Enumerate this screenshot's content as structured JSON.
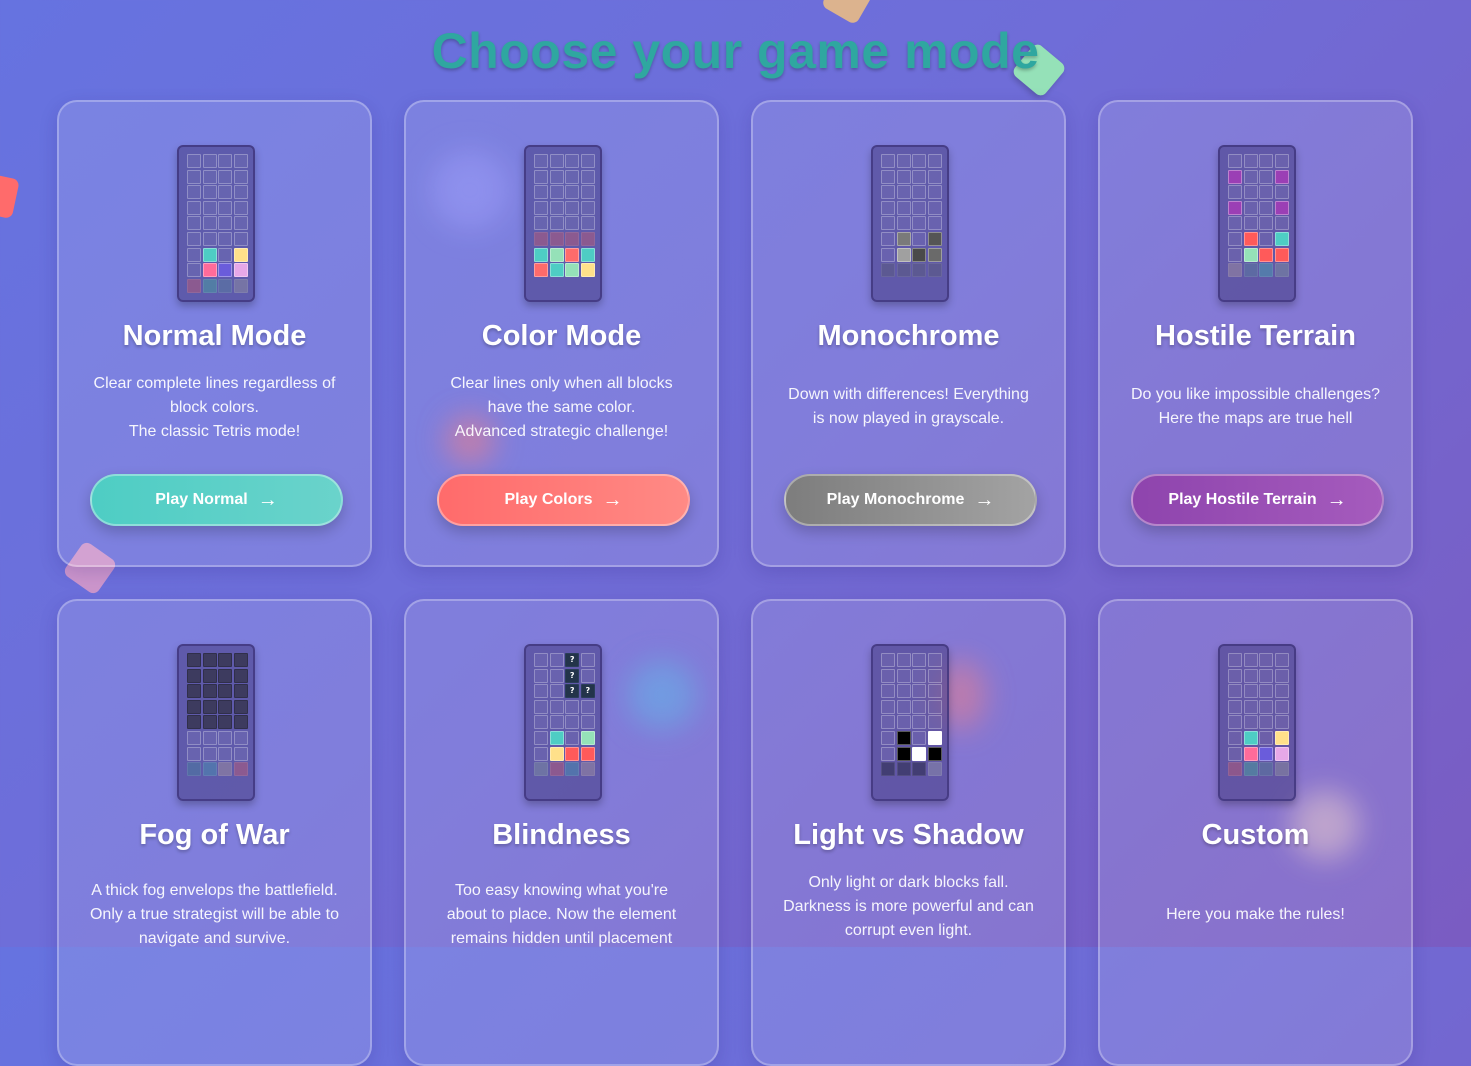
{
  "page": {
    "title": "Choose your game mode"
  },
  "cards": [
    {
      "title": "Normal Mode",
      "description": [
        "Clear complete lines regardless of",
        "block colors.",
        "The classic Tetris mode!"
      ],
      "button": "Play Normal",
      "button_colors": [
        "#4ecdc4",
        "#6ad3cb"
      ],
      "board": [
        "",
        "",
        "",
        "",
        "",
        "",
        "",
        "",
        "",
        "",
        "",
        "",
        "",
        "",
        "",
        "",
        "",
        "",
        "",
        "",
        "",
        "",
        "",
        "",
        "",
        "#4ecdc4",
        "",
        "#ffe08a",
        "",
        "#ff6b9a",
        "#6a5cdb",
        "#e6a8e8",
        "dim:#b05a7a",
        "dim:#4a9aa0",
        "dim:#5a7aa0",
        "dim:#8a8aa0"
      ]
    },
    {
      "title": "Color Mode",
      "description": [
        "Clear lines only when all blocks",
        "have the same color.",
        "Advanced strategic challenge!"
      ],
      "button": "Play Colors",
      "button_colors": [
        "#ff6b6b",
        "#ff8a85"
      ],
      "board": [
        "",
        "",
        "",
        "",
        "",
        "",
        "",
        "",
        "",
        "",
        "",
        "",
        "",
        "",
        "",
        "",
        "",
        "",
        "",
        "",
        "dim:#b05a7a",
        "dim:#b05a7a",
        "dim:#b05a7a",
        "dim:#b05a7a",
        "#4ecdc4",
        "#95e1b8",
        "#ff6b6b",
        "#4ecdc4",
        "#ff6b6b",
        "#4ecdc4",
        "#95e1b8",
        "#ffe08a"
      ]
    },
    {
      "title": "Monochrome",
      "description": [
        "Down with differences! Everything",
        "is now played in grayscale."
      ],
      "button": "Play Monochrome",
      "button_colors": [
        "#7d7d7d",
        "#a3a3a3"
      ],
      "board": [
        "",
        "",
        "",
        "",
        "",
        "",
        "",
        "",
        "",
        "",
        "",
        "",
        "",
        "",
        "",
        "",
        "",
        "",
        "",
        "",
        "",
        "#7a7a7a",
        "",
        "#555555",
        "",
        "#a0a0a0",
        "#4a4a4a",
        "#6a6a6a",
        "dim:#5a5a80",
        "dim:#5a5a80",
        "dim:#5a5a80",
        "dim:#5a5a80"
      ]
    },
    {
      "title": "Hostile Terrain",
      "description": [
        "Do you like impossible challenges?",
        "Here the maps are true hell"
      ],
      "button": "Play Hostile Terrain",
      "button_colors": [
        "#8e44ad",
        "#a55bbd"
      ],
      "board": [
        "",
        "",
        "",
        "",
        "#9b3fb5",
        "",
        "",
        "#9b3fb5",
        "",
        "",
        "",
        "",
        "#9b3fb5",
        "",
        "",
        "#9b3fb5",
        "",
        "",
        "",
        "",
        "",
        "#ff5a5a",
        "",
        "#4ecdc4",
        "",
        "#95e1b8",
        "#ff5a5a",
        "#ff5a5a",
        "dim:#9a8aa0",
        "dim:#5a7aa0",
        "dim:#4a9ab0",
        "dim:#7a8aa0"
      ]
    },
    {
      "title": "Fog of War",
      "description": [
        "A thick fog envelops the battlefield.",
        "Only a true strategist will be able to",
        "navigate and survive."
      ],
      "button": "",
      "button_colors": [
        "#4ecdc4",
        "#6ad3cb"
      ],
      "board": [
        "fog",
        "fog",
        "fog",
        "fog",
        "fog",
        "fog",
        "fog",
        "fog",
        "fog",
        "fog",
        "fog",
        "fog",
        "fog",
        "fog",
        "fog",
        "fog",
        "fog",
        "fog",
        "fog",
        "fog",
        "",
        "",
        "",
        "",
        "",
        "",
        "",
        "",
        "dim:#4a7aa0",
        "dim:#4a8ab0",
        "dim:#9a8aa0",
        "dim:#b05a7a"
      ]
    },
    {
      "title": "Blindness",
      "description": [
        "Too easy knowing what you're",
        "about to place. Now the element",
        "remains hidden until placement"
      ],
      "button": "",
      "button_colors": [
        "#4ecdc4",
        "#6ad3cb"
      ],
      "board": [
        "",
        "",
        "q",
        "",
        "",
        "",
        "q",
        "",
        "",
        "",
        "q",
        "q",
        "",
        "",
        "",
        "",
        "",
        "",
        "",
        "",
        "",
        "#4ecdc4",
        "",
        "#95e1b8",
        "",
        "#ffe08a",
        "#ff5a5a",
        "#ff5a5a",
        "dim:#7a8aa0",
        "dim:#b05a7a",
        "dim:#4a8ab0",
        "dim:#9a8aa0"
      ],
      "hidden_glyph": "?"
    },
    {
      "title": "Light vs Shadow",
      "description": [
        "Only light or dark blocks fall.",
        "Darkness is more powerful and can",
        "corrupt even light."
      ],
      "button": "",
      "button_colors": [
        "#4ecdc4",
        "#6ad3cb"
      ],
      "board": [
        "",
        "",
        "",
        "",
        "",
        "",
        "",
        "",
        "",
        "",
        "",
        "",
        "",
        "",
        "",
        "",
        "",
        "",
        "",
        "",
        "",
        "#000000",
        "",
        "#ffffff",
        "",
        "#000000",
        "#ffffff",
        "#000000",
        "dim:#2a2a4a",
        "dim:#2a2a4a",
        "dim:#2a2a4a",
        "dim:#8a8aaa"
      ]
    },
    {
      "title": "Custom",
      "description": [
        "Here you make the rules!"
      ],
      "button": "",
      "button_colors": [
        "#4ecdc4",
        "#6ad3cb"
      ],
      "board": [
        "",
        "",
        "",
        "",
        "",
        "",
        "",
        "",
        "",
        "",
        "",
        "",
        "",
        "",
        "",
        "",
        "",
        "",
        "",
        "",
        "",
        "#4ecdc4",
        "",
        "#ffe08a",
        "",
        "#ff6b9a",
        "#6a5cdb",
        "#e6a8e8",
        "dim:#b05a7a",
        "dim:#4a9aa0",
        "dim:#5a7aa0",
        "dim:#8a8aa0"
      ]
    }
  ]
}
